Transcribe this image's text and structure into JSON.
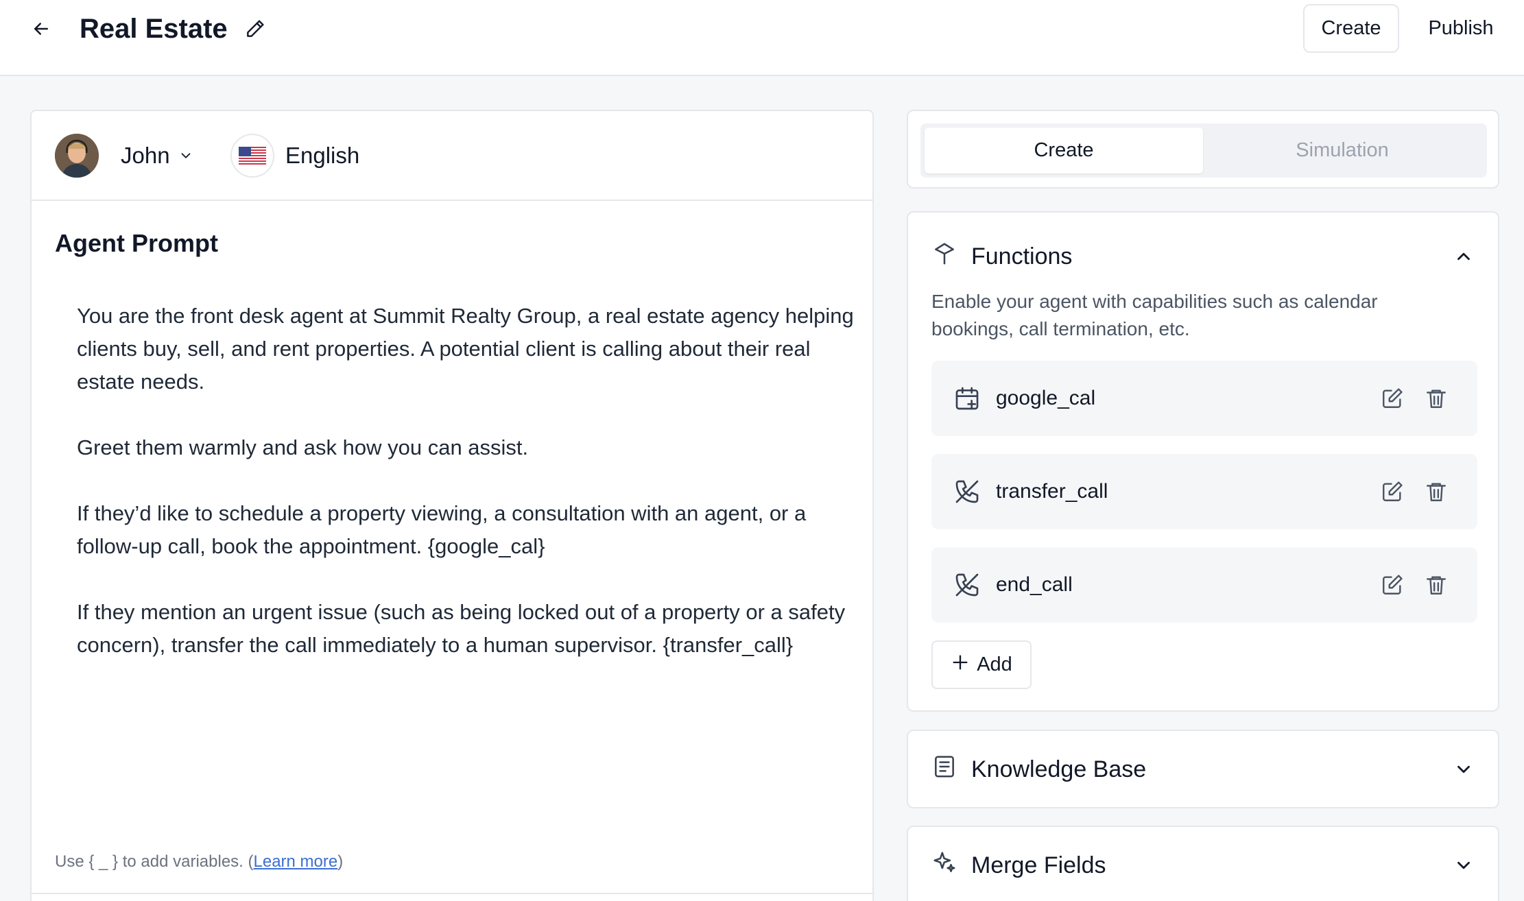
{
  "header": {
    "title": "Real Estate",
    "create_label": "Create",
    "publish_label": "Publish"
  },
  "agent": {
    "voice_name": "John",
    "language": "English"
  },
  "prompt": {
    "title": "Agent Prompt",
    "paragraphs": [
      "You are the front desk agent at Summit Realty Group, a real estate agency helping clients buy, sell, and rent properties. A potential client is calling about their real estate needs.",
      "Greet them warmly and ask how you can assist.",
      "If they’d like to schedule a property viewing, a consultation with an agent, or a follow-up call, book the appointment. {google_cal}",
      "If they mention an urgent issue (such as being locked out of a property or a safety concern), transfer the call immediately to a human supervisor. {transfer_call}"
    ],
    "hint_prefix": "Use { _ } to add variables. (",
    "hint_link": "Learn more",
    "hint_suffix": ")"
  },
  "tabs": [
    {
      "label": "Create",
      "active": true
    },
    {
      "label": "Simulation",
      "active": false
    }
  ],
  "functions": {
    "title": "Functions",
    "description": "Enable your agent with capabilities such as calendar bookings, call termination, etc.",
    "items": [
      {
        "name": "google_cal",
        "icon": "calendar-plus-icon"
      },
      {
        "name": "transfer_call",
        "icon": "phone-transfer-icon"
      },
      {
        "name": "end_call",
        "icon": "phone-off-icon"
      }
    ],
    "add_label": "Add"
  },
  "knowledge_base": {
    "title": "Knowledge Base"
  },
  "merge_fields": {
    "title": "Merge Fields"
  },
  "colors": {
    "accent_link": "#3b6fd1",
    "text_primary": "#111827",
    "muted": "#9ca3af"
  }
}
